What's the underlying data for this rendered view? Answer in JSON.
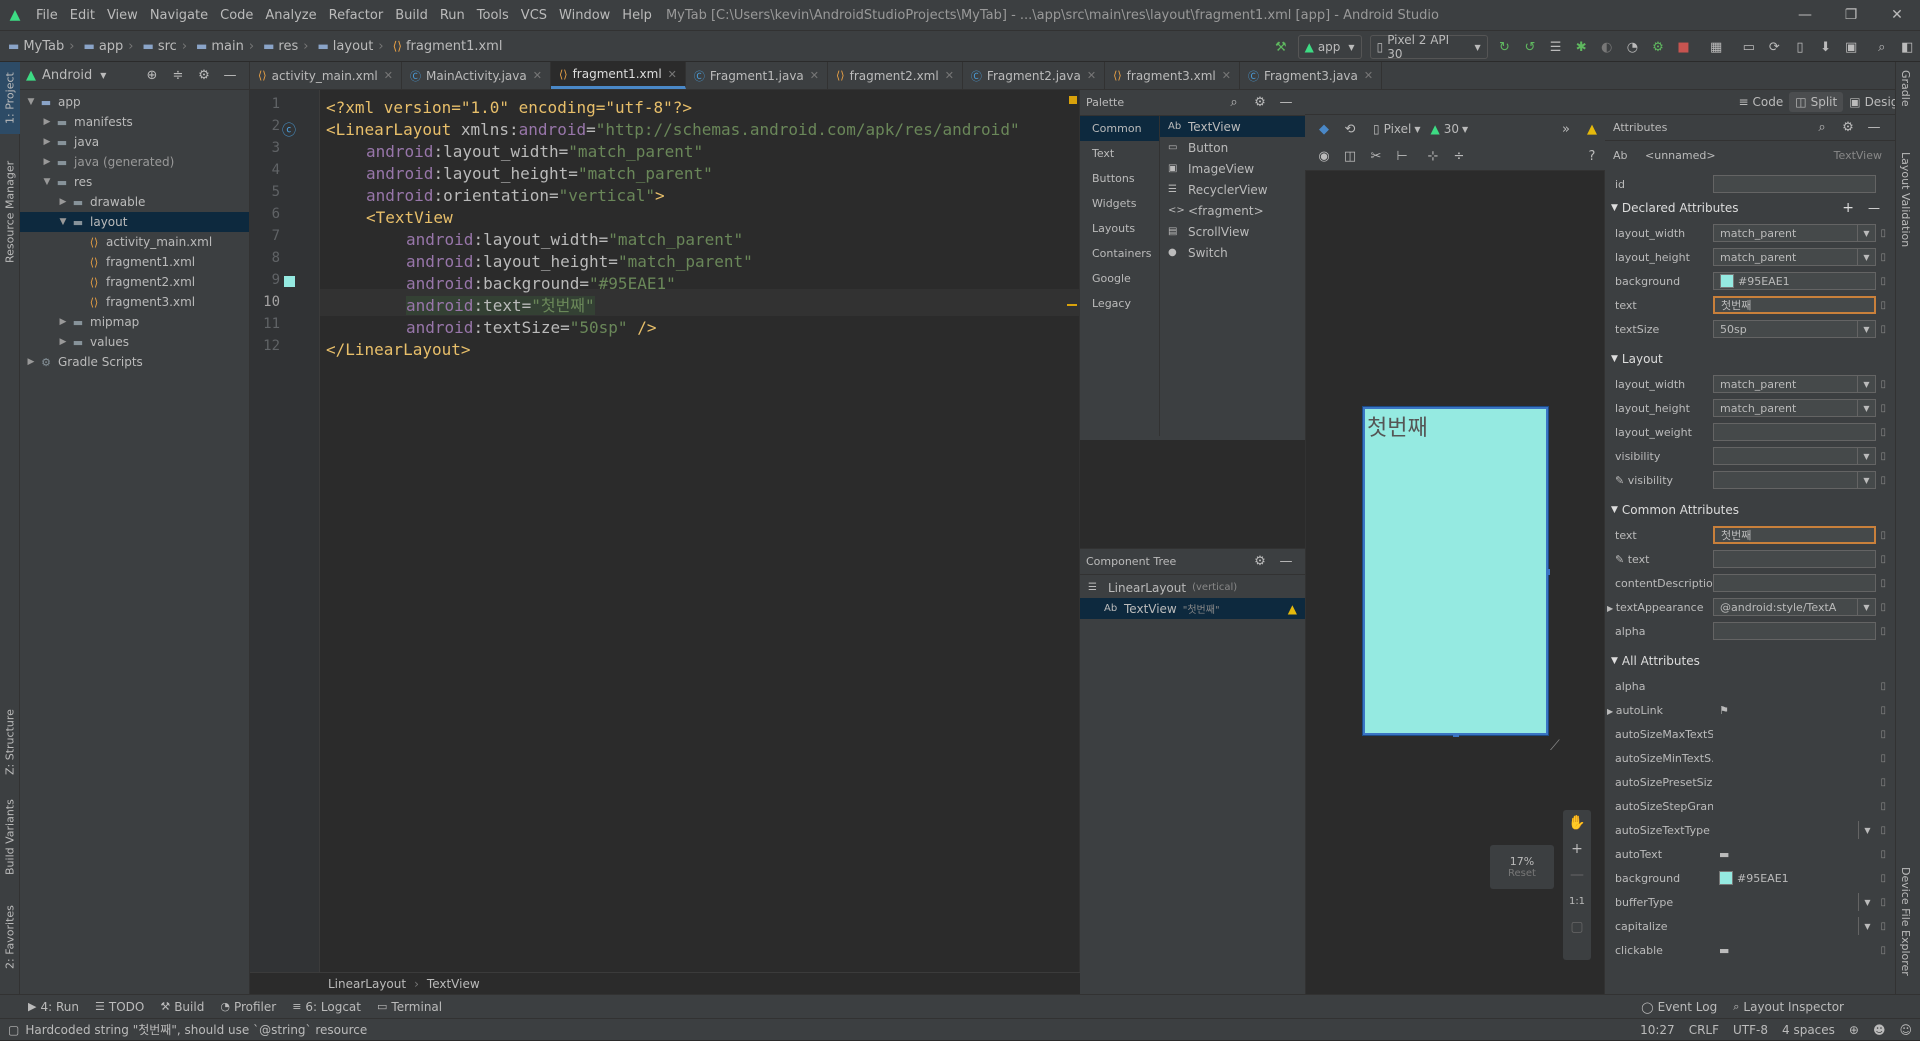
{
  "menubar": {
    "items": [
      "File",
      "Edit",
      "View",
      "Navigate",
      "Code",
      "Analyze",
      "Refactor",
      "Build",
      "Run",
      "Tools",
      "VCS",
      "Window",
      "Help"
    ],
    "title": "MyTab [C:\\Users\\kevin\\AndroidStudioProjects\\MyTab] - ...\\app\\src\\main\\res\\layout\\fragment1.xml [app] - Android Studio"
  },
  "breadcrumb": [
    "MyTab",
    "app",
    "src",
    "main",
    "res",
    "layout",
    "fragment1.xml"
  ],
  "toolbar": {
    "run_config": "app",
    "device": "Pixel 2 API 30"
  },
  "project": {
    "view_label": "Android",
    "tree": [
      {
        "label": "app",
        "depth": 0,
        "arrow": "▼",
        "icon": "folder"
      },
      {
        "label": "manifests",
        "depth": 1,
        "arrow": "▶",
        "icon": "folder"
      },
      {
        "label": "java",
        "depth": 1,
        "arrow": "▶",
        "icon": "folder"
      },
      {
        "label": "java (generated)",
        "depth": 1,
        "arrow": "▶",
        "icon": "folder"
      },
      {
        "label": "res",
        "depth": 1,
        "arrow": "▼",
        "icon": "folder"
      },
      {
        "label": "drawable",
        "depth": 2,
        "arrow": "▶",
        "icon": "folder"
      },
      {
        "label": "layout",
        "depth": 2,
        "arrow": "▼",
        "icon": "folder",
        "selected": true
      },
      {
        "label": "activity_main.xml",
        "depth": 3,
        "arrow": "",
        "icon": "xml"
      },
      {
        "label": "fragment1.xml",
        "depth": 3,
        "arrow": "",
        "icon": "xml"
      },
      {
        "label": "fragment2.xml",
        "depth": 3,
        "arrow": "",
        "icon": "xml"
      },
      {
        "label": "fragment3.xml",
        "depth": 3,
        "arrow": "",
        "icon": "xml"
      },
      {
        "label": "mipmap",
        "depth": 2,
        "arrow": "▶",
        "icon": "folder"
      },
      {
        "label": "values",
        "depth": 2,
        "arrow": "▶",
        "icon": "folder"
      },
      {
        "label": "Gradle Scripts",
        "depth": 0,
        "arrow": "▶",
        "icon": "gradle"
      }
    ]
  },
  "tabs": [
    {
      "label": "activity_main.xml",
      "type": "xml"
    },
    {
      "label": "MainActivity.java",
      "type": "java"
    },
    {
      "label": "fragment1.xml",
      "type": "xml",
      "active": true
    },
    {
      "label": "Fragment1.java",
      "type": "java"
    },
    {
      "label": "fragment2.xml",
      "type": "xml"
    },
    {
      "label": "Fragment2.java",
      "type": "java"
    },
    {
      "label": "fragment3.xml",
      "type": "xml"
    },
    {
      "label": "Fragment3.java",
      "type": "java"
    }
  ],
  "code": {
    "line_numbers": [
      "1",
      "2",
      "3",
      "4",
      "5",
      "6",
      "7",
      "8",
      "9",
      "10",
      "11",
      "12"
    ],
    "current_line": "10",
    "lines": {
      "l1": [
        "<?xml version=\"1.0\" encoding=\"utf-8\"?>"
      ],
      "l2": [
        "<LinearLayout ",
        "xmlns:",
        "android",
        "=",
        "\"http://schemas.android.com/apk/res/android\""
      ],
      "l3": [
        "android",
        ":layout_width=",
        "\"match_parent\""
      ],
      "l4": [
        "android",
        ":layout_height=",
        "\"match_parent\""
      ],
      "l5": [
        "android",
        ":orientation=",
        "\"vertical\"",
        ">"
      ],
      "l6": [
        "<TextView"
      ],
      "l7": [
        "android",
        ":layout_width=",
        "\"match_parent\""
      ],
      "l8": [
        "android",
        ":layout_height=",
        "\"match_parent\""
      ],
      "l9": [
        "android",
        ":background=",
        "\"#95EAE1\""
      ],
      "l10": [
        "android",
        ":text=",
        "\"첫번째\""
      ],
      "l11": [
        "android",
        ":textSize=",
        "\"50sp\"",
        " />"
      ],
      "l12": [
        "</LinearLayout>"
      ]
    }
  },
  "editor_breadcrumb": [
    "LinearLayout",
    "TextView"
  ],
  "palette": {
    "title": "Palette",
    "categories": [
      "Common",
      "Text",
      "Buttons",
      "Widgets",
      "Layouts",
      "Containers",
      "Google",
      "Legacy"
    ],
    "items": [
      {
        "icon": "Ab",
        "label": "TextView"
      },
      {
        "icon": "▭",
        "label": "Button"
      },
      {
        "icon": "▣",
        "label": "ImageView"
      },
      {
        "icon": "☰",
        "label": "RecyclerView"
      },
      {
        "icon": "<>",
        "label": "<fragment>"
      },
      {
        "icon": "▤",
        "label": "ScrollView"
      },
      {
        "icon": "●",
        "label": "Switch"
      }
    ]
  },
  "component_tree": {
    "title": "Component Tree",
    "root_label": "LinearLayout",
    "root_hint": "(vertical)",
    "child_label": "TextView",
    "child_hint": "\"첫번째\""
  },
  "design": {
    "modes": [
      "Code",
      "Split",
      "Design"
    ],
    "active_mode": "Split",
    "device": "Pixel",
    "api": "30",
    "preview_text": "첫번째",
    "preview_color": "#95EAE1",
    "zoom": "17%",
    "reset": "Reset",
    "ratio": "1:1"
  },
  "attributes": {
    "title": "Attributes",
    "widget_name": "<unnamed>",
    "widget_type": "TextView",
    "id_label": "id",
    "sections": {
      "declared": "Declared Attributes",
      "layout": "Layout",
      "common": "Common Attributes",
      "all": "All Attributes"
    },
    "declared": [
      {
        "name": "layout_width",
        "value": "match_parent",
        "dd": true
      },
      {
        "name": "layout_height",
        "value": "match_parent",
        "dd": true
      },
      {
        "name": "background",
        "value": "#95EAE1",
        "swatch": true
      },
      {
        "name": "text",
        "value": "첫번째",
        "focus": true
      },
      {
        "name": "textSize",
        "value": "50sp",
        "dd": true
      }
    ],
    "layout": [
      {
        "name": "layout_width",
        "value": "match_parent",
        "dd": true
      },
      {
        "name": "layout_height",
        "value": "match_parent",
        "dd": true
      },
      {
        "name": "layout_weight",
        "value": ""
      },
      {
        "name": "visibility",
        "value": "",
        "dd": true
      },
      {
        "name": "visibility",
        "value": "",
        "dd": true,
        "tool": true
      }
    ],
    "common": [
      {
        "name": "text",
        "value": "첫번째",
        "focus": true
      },
      {
        "name": "text",
        "value": "",
        "tool": true
      },
      {
        "name": "contentDescription",
        "value": ""
      },
      {
        "name": "textAppearance",
        "value": "@android:style/TextA",
        "dd": true,
        "expand": true
      },
      {
        "name": "alpha",
        "value": ""
      }
    ],
    "all": [
      {
        "name": "alpha",
        "value": "",
        "plain": true
      },
      {
        "name": "autoLink",
        "value": "⚑",
        "plain": true,
        "expand": true
      },
      {
        "name": "autoSizeMaxTextS...",
        "value": "",
        "plain": true
      },
      {
        "name": "autoSizeMinTextS...",
        "value": "",
        "plain": true
      },
      {
        "name": "autoSizePresetSiz...",
        "value": "",
        "plain": true
      },
      {
        "name": "autoSizeStepGran...",
        "value": "",
        "plain": true
      },
      {
        "name": "autoSizeTextType",
        "value": "",
        "plain": true,
        "dd": true
      },
      {
        "name": "autoText",
        "value": "▬",
        "plain": true
      },
      {
        "name": "background",
        "value": "#95EAE1",
        "plain": true,
        "swatch": true
      },
      {
        "name": "bufferType",
        "value": "",
        "plain": true,
        "dd": true
      },
      {
        "name": "capitalize",
        "value": "",
        "plain": true,
        "dd": true
      },
      {
        "name": "clickable",
        "value": "▬",
        "plain": true
      }
    ]
  },
  "left_tabs": [
    "1: Project",
    "Resource Manager",
    "Z: Structure",
    "Build Variants",
    "2: Favorites"
  ],
  "right_tabs": [
    "Gradle",
    "Layout Validation",
    "Device File Explorer"
  ],
  "bottom_tabs": [
    {
      "icon": "▶",
      "label": "4: Run"
    },
    {
      "icon": "☰",
      "label": "TODO"
    },
    {
      "icon": "⚒",
      "label": "Build"
    },
    {
      "icon": "◔",
      "label": "Profiler"
    },
    {
      "icon": "≡",
      "label": "6: Logcat"
    },
    {
      "icon": "▭",
      "label": "Terminal"
    }
  ],
  "bottom_right": [
    {
      "icon": "◯",
      "label": "Event Log"
    },
    {
      "icon": "⌕",
      "label": "Layout Inspector"
    }
  ],
  "status": {
    "message": "Hardcoded string \"첫번째\", should use `@string` resource",
    "position": "10:27",
    "line_sep": "CRLF",
    "encoding": "UTF-8",
    "indent": "4 spaces"
  }
}
